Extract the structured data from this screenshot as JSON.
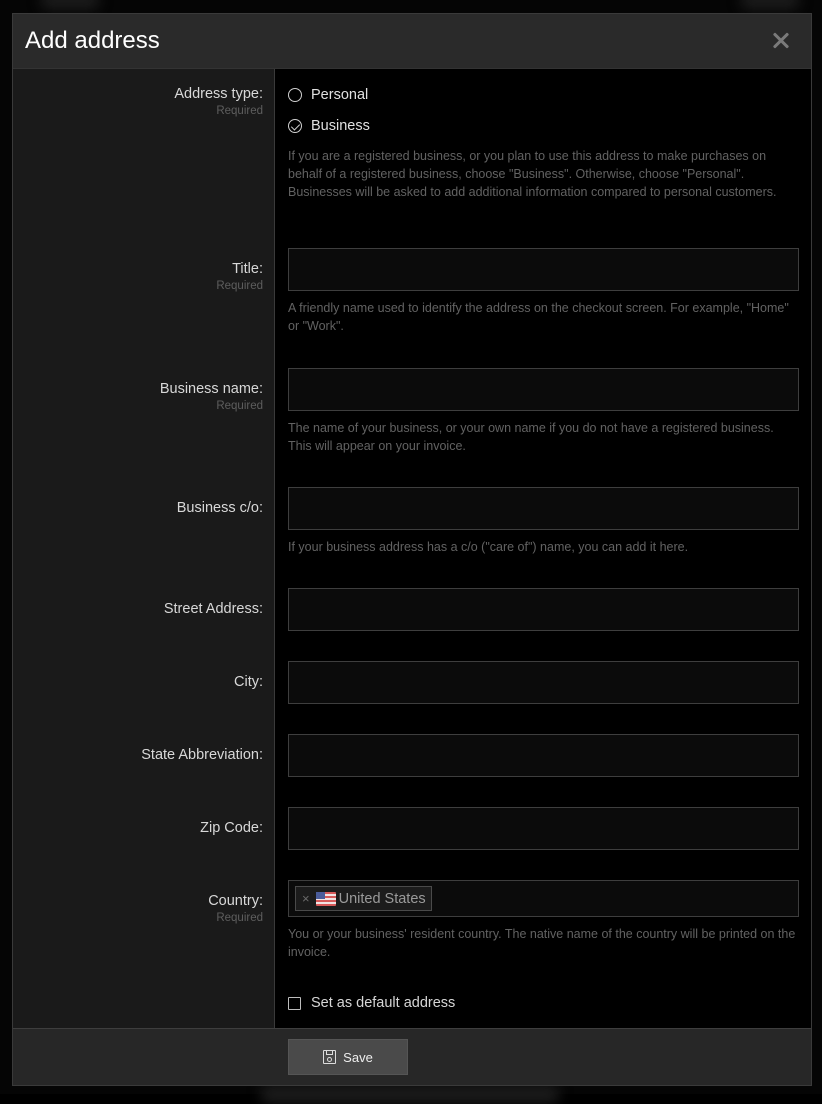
{
  "dialog": {
    "title": "Add address",
    "close_label": "×"
  },
  "required_text": "Required",
  "address_type": {
    "label": "Address type:",
    "required": "Required",
    "options": [
      {
        "label": "Personal",
        "checked": false
      },
      {
        "label": "Business",
        "checked": true
      }
    ],
    "help": "If you are a registered business, or you plan to use this address to make purchases on behalf of a registered business, choose \"Business\". Otherwise, choose \"Personal\". Businesses will be asked to add additional information compared to personal customers."
  },
  "fields": {
    "title": {
      "label": "Title:",
      "required": "Required",
      "value": "",
      "help": "A friendly name used to identify the address on the checkout screen. For example, \"Home\" or \"Work\"."
    },
    "business_name": {
      "label": "Business name:",
      "required": "Required",
      "value": "",
      "help": "The name of your business, or your own name if you do not have a registered business. This will appear on your invoice."
    },
    "business_co": {
      "label": "Business c/o:",
      "value": "",
      "help": "If your business address has a c/o (\"care of\") name, you can add it here."
    },
    "street": {
      "label": "Street Address:",
      "value": ""
    },
    "city": {
      "label": "City:",
      "value": ""
    },
    "state": {
      "label": "State Abbreviation:",
      "value": ""
    },
    "zip": {
      "label": "Zip Code:",
      "value": ""
    },
    "country": {
      "label": "Country:",
      "required": "Required",
      "selected": "United States",
      "remove_label": "×",
      "help": "You or your business' resident country. The native name of the country will be printed on the invoice."
    }
  },
  "default_address": {
    "label": "Set as default address",
    "checked": false
  },
  "footer": {
    "save_label": "Save"
  }
}
